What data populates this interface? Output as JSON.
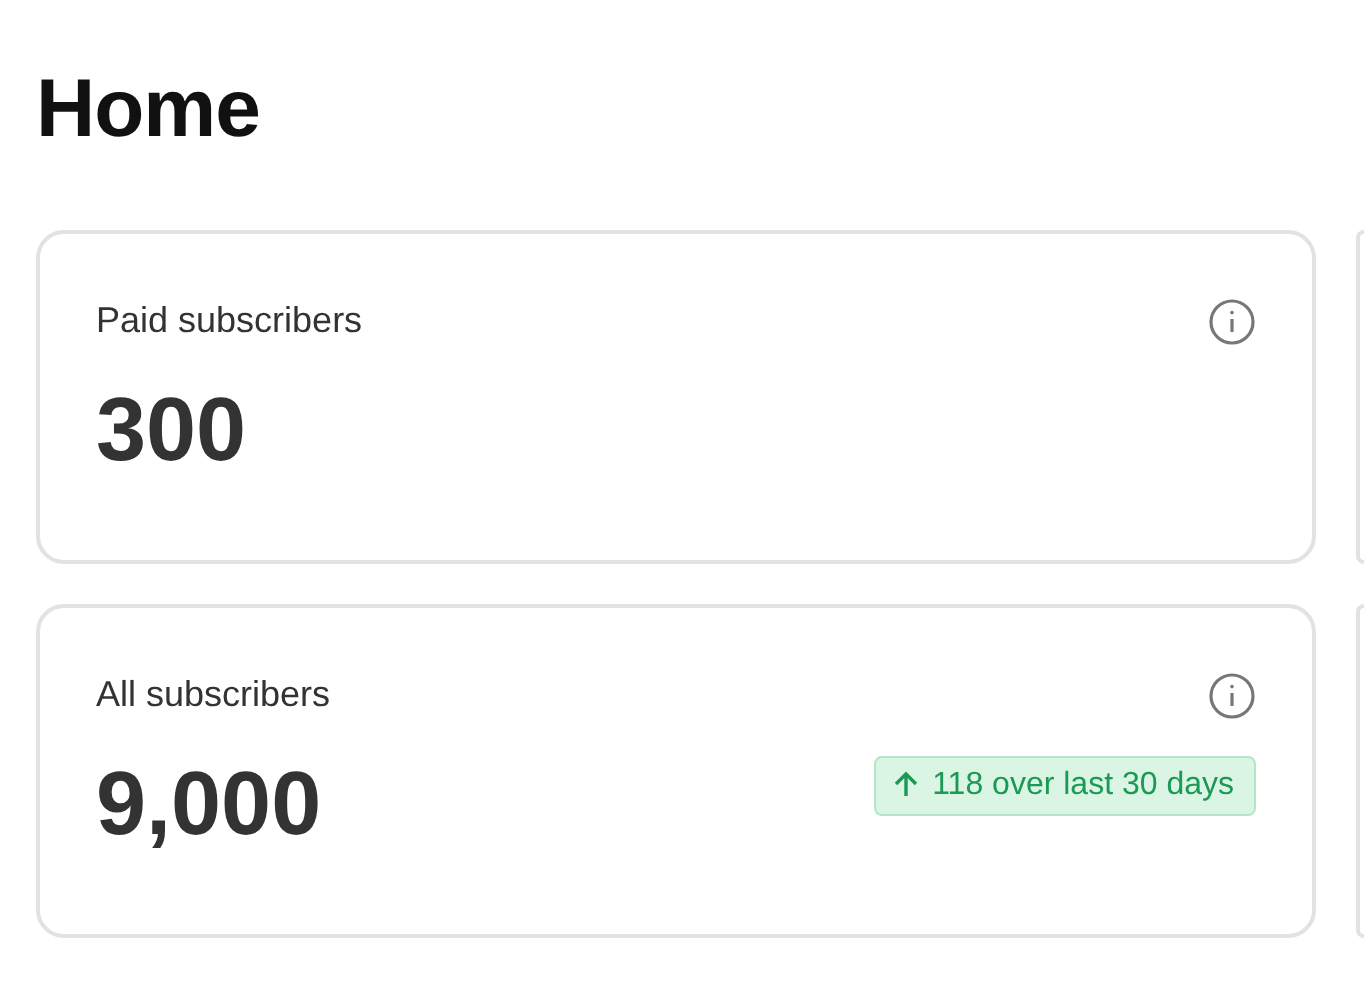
{
  "page": {
    "title": "Home"
  },
  "stats": [
    {
      "label": "Paid subscribers",
      "value": "300"
    },
    {
      "label": "All subscribers",
      "value": "9,000",
      "trend": {
        "up": true,
        "text": "118 over last 30 days"
      }
    }
  ]
}
